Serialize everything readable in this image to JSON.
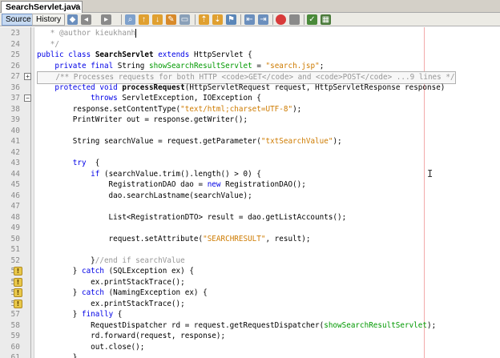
{
  "editor_tab": {
    "filename": "SearchServlet.java",
    "close_glyph": "×"
  },
  "view_switch": {
    "source": "Source",
    "history": "History"
  },
  "icons": {
    "toolbar": [
      "last-edit-icon",
      "back-icon",
      "forward-icon",
      "find-selection-icon",
      "find-previous-icon",
      "find-next-icon",
      "toggle-highlight-icon",
      "toggle-rect-selection-icon",
      "shift-left-icon",
      "shift-right-icon",
      "start-macro-icon",
      "stop-macro-icon",
      "comment-icon",
      "uncomment-icon"
    ],
    "warning": "warning-bulb-icon"
  },
  "colors": {
    "keyword": "#0000e6",
    "string": "#ce7b00",
    "comment": "#969696",
    "field": "#009900",
    "margin": "#f2aaaa"
  },
  "code_lines": [
    {
      "n": "23",
      "t": "   * @author kieukhanh"
    },
    {
      "n": "24",
      "t": "   */"
    },
    {
      "n": "25",
      "t": "public class SearchServlet extends HttpServlet {"
    },
    {
      "n": "26",
      "t": "    private final String showSearchResultServlet = \"search.jsp\";"
    },
    {
      "n": "27",
      "t": "    /** Processes requests for both HTTP <code>GET</code> and <code>POST</code> ...9 lines */"
    },
    {
      "n": "36",
      "t": "    protected void processRequest(HttpServletRequest request, HttpServletResponse response)"
    },
    {
      "n": "37",
      "t": "            throws ServletException, IOException {"
    },
    {
      "n": "38",
      "t": "        response.setContentType(\"text/html;charset=UTF-8\");"
    },
    {
      "n": "39",
      "t": "        PrintWriter out = response.getWriter();"
    },
    {
      "n": "40",
      "t": ""
    },
    {
      "n": "41",
      "t": "        String searchValue = request.getParameter(\"txtSearchValue\");"
    },
    {
      "n": "42",
      "t": ""
    },
    {
      "n": "43",
      "t": "        try  {"
    },
    {
      "n": "44",
      "t": "            if (searchValue.trim().length() > 0) {"
    },
    {
      "n": "45",
      "t": "                RegistrationDAO dao = new RegistrationDAO();"
    },
    {
      "n": "46",
      "t": "                dao.searchLastname(searchValue);"
    },
    {
      "n": "47",
      "t": ""
    },
    {
      "n": "48",
      "t": "                List<RegistrationDTO> result = dao.getListAccounts();"
    },
    {
      "n": "49",
      "t": ""
    },
    {
      "n": "50",
      "t": "                request.setAttribute(\"SEARCHRESULT\", result);"
    },
    {
      "n": "51",
      "t": ""
    },
    {
      "n": "52",
      "t": "            }//end if searchValue"
    },
    {
      "n": "53",
      "t": "        } catch (SQLException ex) {"
    },
    {
      "n": "54",
      "t": "            ex.printStackTrace();"
    },
    {
      "n": "55",
      "t": "        } catch (NamingException ex) {"
    },
    {
      "n": "56",
      "t": "            ex.printStackTrace();"
    },
    {
      "n": "57",
      "t": "        } finally {"
    },
    {
      "n": "58",
      "t": "            RequestDispatcher rd = request.getRequestDispatcher(showSearchResultServlet);"
    },
    {
      "n": "59",
      "t": "            rd.forward(request, response);"
    },
    {
      "n": "60",
      "t": "            out.close();"
    },
    {
      "n": "61",
      "t": "        }"
    }
  ]
}
